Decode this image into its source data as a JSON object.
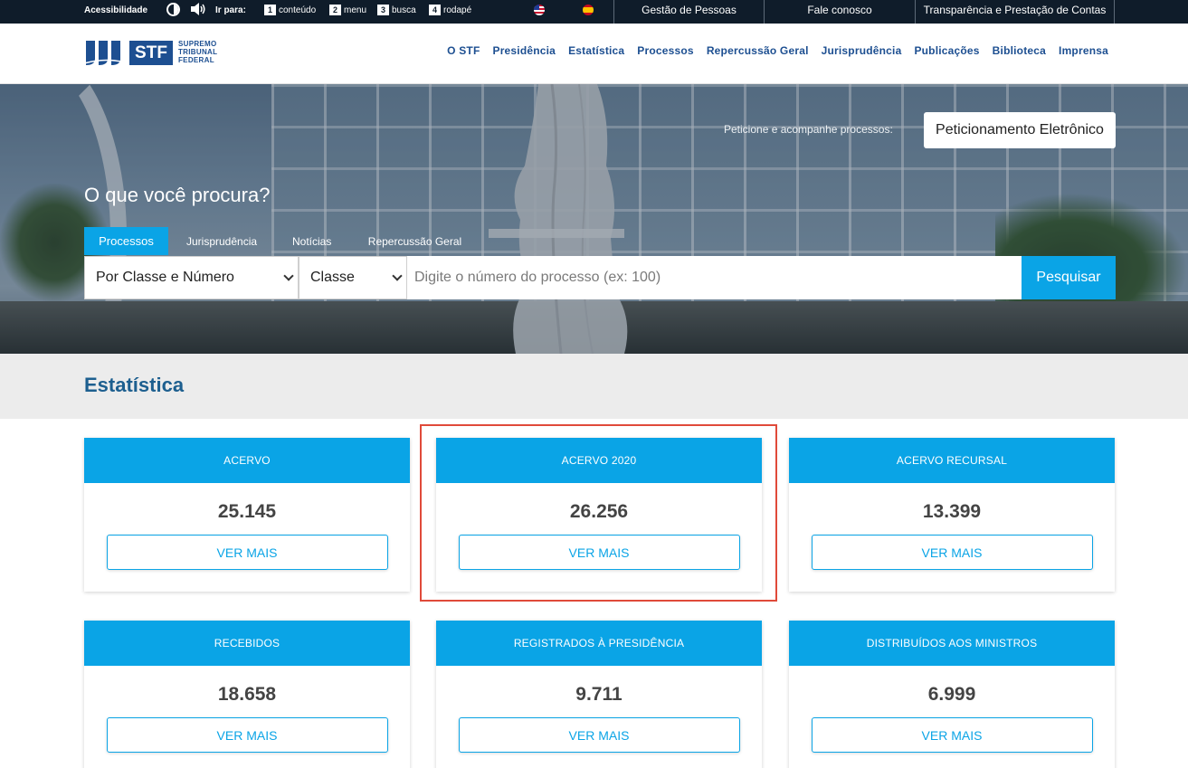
{
  "topbar": {
    "accessibility": "Acessibilidade",
    "goto": "Ir para:",
    "skips": [
      {
        "num": "1",
        "label": "conteúdo"
      },
      {
        "num": "2",
        "label": "menu"
      },
      {
        "num": "3",
        "label": "busca"
      },
      {
        "num": "4",
        "label": "rodapé"
      }
    ],
    "links": [
      "Gestão de Pessoas",
      "Fale conosco",
      "Transparência e Prestação de Contas"
    ]
  },
  "header": {
    "logo_abbr": "STF",
    "logo_words": [
      "SUPREMO",
      "TRIBUNAL",
      "FEDERAL"
    ],
    "nav": [
      "O STF",
      "Presidência",
      "Estatística",
      "Processos",
      "Repercussão Geral",
      "Jurisprudência",
      "Publicações",
      "Biblioteca",
      "Imprensa"
    ]
  },
  "hero": {
    "peticione_text": "Peticione e acompanhe processos:",
    "peticione_button": "Peticionamento Eletrônico",
    "question": "O que você procura?",
    "tabs": [
      "Processos",
      "Jurisprudência",
      "Notícias",
      "Repercussão Geral"
    ],
    "select_type": "Por Classe e Número",
    "select_class": "Classe",
    "search_placeholder": "Digite o número do processo (ex: 100)",
    "search_button": "Pesquisar"
  },
  "stats": {
    "title": "Estatística",
    "button_label": "VER MAIS",
    "cards": [
      {
        "title": "ACERVO",
        "value": "25.145"
      },
      {
        "title": "ACERVO 2020",
        "value": "26.256"
      },
      {
        "title": "ACERVO RECURSAL",
        "value": "13.399"
      },
      {
        "title": "RECEBIDOS",
        "value": "18.658"
      },
      {
        "title": "REGISTRADOS À PRESIDÊNCIA",
        "value": "9.711"
      },
      {
        "title": "DISTRIBUÍDOS AOS MINISTROS",
        "value": "6.999"
      }
    ]
  },
  "colors": {
    "accent": "#0aa4e6",
    "brand": "#1d4f91",
    "topbar": "#0f1c2a",
    "highlight": "#e04a3a"
  }
}
